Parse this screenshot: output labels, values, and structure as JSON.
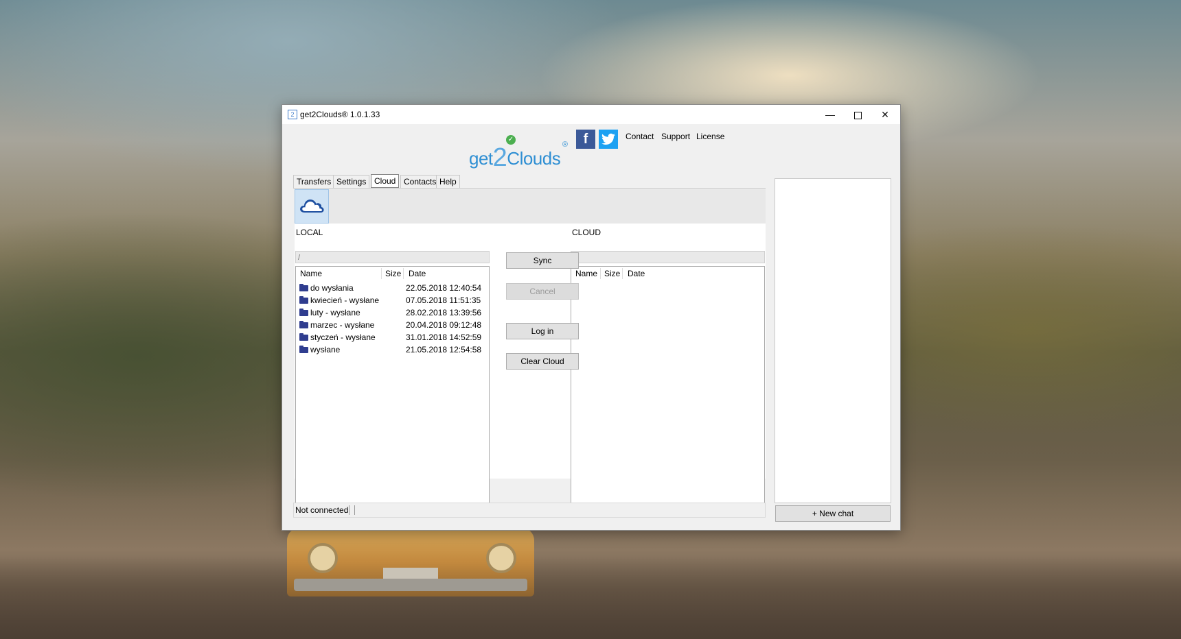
{
  "window": {
    "title": "get2Clouds® 1.0.1.33",
    "app_icon_glyph": "2",
    "controls": {
      "minimize": "—",
      "maximize": "☐",
      "close": "✕"
    }
  },
  "header": {
    "logo": {
      "pre": "get",
      "num": "2",
      "post": "Clouds",
      "reg": "®"
    },
    "facebook_glyph": "f",
    "twitter_glyph": "🐦",
    "links": {
      "contact": "Contact",
      "support": "Support",
      "license": "License"
    }
  },
  "tabs": [
    {
      "label": "Transfers"
    },
    {
      "label": "Settings"
    },
    {
      "label": "Cloud",
      "active": true
    },
    {
      "label": "Contacts"
    },
    {
      "label": "Help"
    }
  ],
  "local": {
    "label": "LOCAL",
    "path": "/",
    "columns": {
      "name": "Name",
      "size": "Size",
      "date": "Date"
    },
    "rows": [
      {
        "name": "do wysłania",
        "date": "22.05.2018 12:40:54"
      },
      {
        "name": "kwiecień - wysłane",
        "date": "07.05.2018 11:51:35"
      },
      {
        "name": "luty - wysłane",
        "date": "28.02.2018 13:39:56"
      },
      {
        "name": "marzec - wysłane",
        "date": "20.04.2018 09:12:48"
      },
      {
        "name": "styczeń - wysłane",
        "date": "31.01.2018 14:52:59"
      },
      {
        "name": "wysłane",
        "date": "21.05.2018 12:54:58"
      }
    ]
  },
  "cloud": {
    "label": "CLOUD",
    "path": "/",
    "columns": {
      "name": "Name",
      "size": "Size",
      "date": "Date"
    }
  },
  "actions": {
    "sync": "Sync",
    "cancel": "Cancel",
    "login": "Log in",
    "clear_cloud": "Clear Cloud"
  },
  "status": {
    "text": "Not connected"
  },
  "chat": {
    "new_chat": "+ New chat"
  },
  "colors": {
    "accent": "#2f8fd3",
    "folder": "#2f3d8f",
    "facebook": "#3b5998",
    "twitter": "#1da1f2"
  }
}
